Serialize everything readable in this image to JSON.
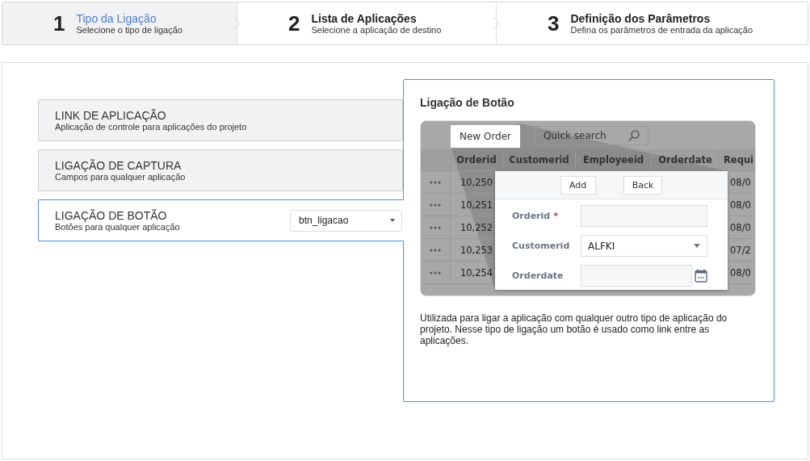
{
  "steps": [
    {
      "number": "1",
      "title": "Tipo da Ligação",
      "subtitle": "Selecione o tipo de ligação",
      "selected": true
    },
    {
      "number": "2",
      "title": "Lista de Aplicações",
      "subtitle": "Selecione a aplicação de destino",
      "selected": false
    },
    {
      "number": "3",
      "title": "Definição dos Parâmetros",
      "subtitle": "Defina os parâmetros de entrada da aplicação",
      "selected": false
    }
  ],
  "link_types": [
    {
      "title": "LINK DE APLICAÇÃO",
      "subtitle": "Aplicação de controle para aplicações do projeto",
      "selected": false
    },
    {
      "title": "LIGAÇÃO DE CAPTURA",
      "subtitle": "Campos para qualquer aplicação",
      "selected": false
    },
    {
      "title": "LIGAÇÃO DE BOTÃO",
      "subtitle": "Botões para qualquer aplicação",
      "selected": true,
      "dropdown_value": "btn_ligacao"
    }
  ],
  "preview": {
    "title": "Ligação de Botão",
    "toolbar": {
      "button": "New Order",
      "search_placeholder": "Quick search"
    },
    "columns": [
      "Orderid",
      "Customerid",
      "Employeeid",
      "Orderdate",
      "Requi"
    ],
    "rows": [
      [
        "10,250",
        null,
        null,
        null,
        "08/0"
      ],
      [
        "10,251",
        null,
        null,
        null,
        "08/0"
      ],
      [
        "10,252",
        null,
        null,
        null,
        "08/0"
      ],
      [
        "10,253",
        null,
        null,
        null,
        "07/2"
      ],
      [
        "10,254",
        null,
        null,
        null,
        "08/0"
      ]
    ],
    "form": {
      "buttons": [
        "Add",
        "Back"
      ],
      "fields": [
        {
          "label": "Orderid",
          "required_mark": "*",
          "kind": "text"
        },
        {
          "label": "Customerid",
          "kind": "select",
          "value": "ALFKI"
        },
        {
          "label": "Orderdate",
          "kind": "date"
        }
      ]
    }
  },
  "description": "Utilizada para ligar a aplicação com qualquer outro tipo de aplicação do projeto. Nesse tipo de ligação um botão é usado como link entre as aplicações."
}
